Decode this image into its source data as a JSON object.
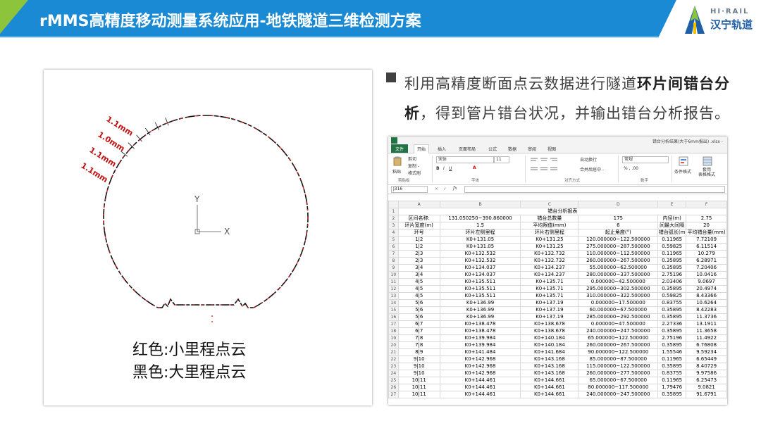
{
  "header": {
    "title": "rMMS高精度移动测量系统应用-地铁隧道三维检测方案",
    "logo_top": "HI·RAIL",
    "logo_cn": "汉宁轨道",
    "colors": {
      "blue": "#1b8ad4",
      "green": "#8cc43c"
    }
  },
  "figure": {
    "axis_y": "Y",
    "axis_x": "X",
    "legend_red": "红色:小里程点云",
    "legend_black": "黑色:大里程点云"
  },
  "description": {
    "part1": "利用高精度断面点云数据进行隧道",
    "bold": "环片间错台分析",
    "part2": "，得到管片错台状况，并输出错台分析报告。"
  },
  "excel": {
    "window_title": "错台分析结果(大于6mm报出) .xlsx -",
    "tabs": [
      "文件",
      "开始",
      "插入",
      "页面布局",
      "公式",
      "数据",
      "审阅",
      "视图"
    ],
    "ribbon": {
      "cut": "剪切",
      "copy": "复制 -",
      "paste": "粘贴",
      "format_painter": "格式刷",
      "font": "宋体",
      "size": "11",
      "wrap": "自动换行",
      "merge": "合并后居中 -",
      "number_format": "常规",
      "cond_format": "条件格式",
      "table_format": "套用\n表格格式",
      "groups": [
        "剪贴板",
        "字体",
        "对齐方式",
        "数字"
      ]
    },
    "name_box": "J316",
    "fx": "fx",
    "col_letters": [
      "A",
      "B",
      "C",
      "D",
      "E",
      "F"
    ],
    "report_title": "错台分析报表",
    "info_rows": [
      [
        "区间名称:",
        "131.050250~390.860000",
        "错台总数量",
        "175",
        "内径(m)",
        "2.75"
      ],
      [
        "环片宽度(m)",
        "1.5",
        "平均限值(mm)",
        "6",
        "间最大间隔",
        "20"
      ]
    ],
    "headers": [
      "环号",
      "环片左侧里程",
      "环片右侧里程",
      "起止角度(°)",
      "错台弧长(m",
      "平均错台量(mm)"
    ],
    "rows": [
      [
        "1|2",
        "K0+131.05",
        "K0+131.25",
        "120.000000~122.500000",
        "0.11965",
        "7.72109"
      ],
      [
        "1|2",
        "K0+131.05",
        "K0+131.25",
        "275.000000~287.500000",
        "0.59825",
        "6.11514"
      ],
      [
        "2|3",
        "K0+132.532",
        "K0+132.732",
        "110.000000~112.500000",
        "0.11965",
        "10.279"
      ],
      [
        "2|3",
        "K0+132.532",
        "K0+132.732",
        "260.000000~267.500000",
        "0.35895",
        "6.28971"
      ],
      [
        "3|4",
        "K0+134.037",
        "K0+134.237",
        "55.000000~62.500000",
        "0.35895",
        "7.20406"
      ],
      [
        "3|4",
        "K0+134.037",
        "K0+134.237",
        "280.000000~337.500000",
        "2.75196",
        "10.0416"
      ],
      [
        "4|5",
        "K0+135.511",
        "K0+135.71",
        "0.000000~42.500000",
        "2.03406",
        "9.0697"
      ],
      [
        "4|5",
        "K0+135.511",
        "K0+135.71",
        "295.000000~302.500000",
        "0.35895",
        "20.4974"
      ],
      [
        "4|5",
        "K0+135.511",
        "K0+135.71",
        "310.000000~322.500000",
        "0.59825",
        "8.43366"
      ],
      [
        "5|6",
        "K0+136.99",
        "K0+137.19",
        "0.000000~17.500000",
        "0.83755",
        "10.6264"
      ],
      [
        "5|6",
        "K0+136.99",
        "K0+137.19",
        "60.000000~67.500000",
        "0.35895",
        "8.42283"
      ],
      [
        "5|6",
        "K0+136.99",
        "K0+137.19",
        "285.000000~292.500000",
        "0.35895",
        "11.3736"
      ],
      [
        "6|7",
        "K0+138.478",
        "K0+138.678",
        "0.000000~47.500000",
        "2.27336",
        "13.1911"
      ],
      [
        "6|7",
        "K0+138.478",
        "K0+138.678",
        "240.000000~247.500000",
        "0.35895",
        "11.3658"
      ],
      [
        "7|8",
        "K0+139.984",
        "K0+140.184",
        "65.000000~122.500000",
        "2.75196",
        "11.4922"
      ],
      [
        "7|8",
        "K0+139.984",
        "K0+140.184",
        "260.000000~267.500000",
        "0.35895",
        "6.76808"
      ],
      [
        "8|9",
        "K0+141.484",
        "K0+141.684",
        "90.000000~122.500000",
        "1.55546",
        "9.59234"
      ],
      [
        "9|10",
        "K0+142.968",
        "K0+143.168",
        "85.000000~87.500000",
        "0.11965",
        "6.65449"
      ],
      [
        "9|10",
        "K0+142.968",
        "K0+143.168",
        "115.000000~122.500000",
        "0.35895",
        "8.40729"
      ],
      [
        "9|10",
        "K0+142.968",
        "K0+143.168",
        "260.000000~277.500000",
        "0.83755",
        "9.97586"
      ],
      [
        "10|11",
        "K0+144.461",
        "K0+144.661",
        "65.000000~67.500000",
        "0.11965",
        "6.25473"
      ],
      [
        "10|11",
        "K0+144.461",
        "K0+144.661",
        "80.000000~117.500000",
        "1.79476",
        "9.0821"
      ],
      [
        "10|11",
        "K0+144.461",
        "K0+144.661",
        "240.000000~247.500000",
        "0.35895",
        "91.6791"
      ]
    ]
  }
}
